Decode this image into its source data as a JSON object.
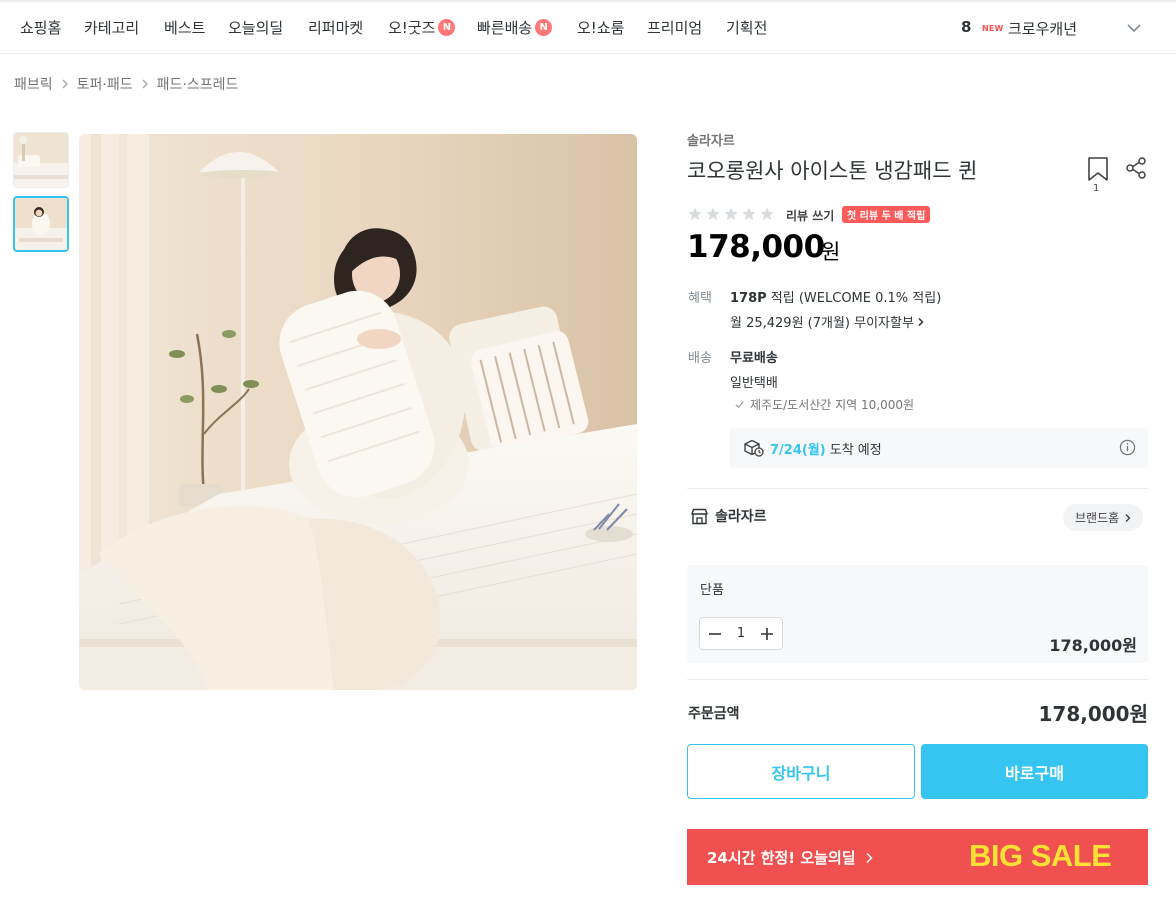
{
  "nav": {
    "items": [
      {
        "label": "쇼핑홈",
        "badge": ""
      },
      {
        "label": "카테고리",
        "badge": ""
      },
      {
        "label": "베스트",
        "badge": ""
      },
      {
        "label": "오늘의딜",
        "badge": ""
      },
      {
        "label": "리퍼마켓",
        "badge": ""
      },
      {
        "label": "오!굿즈",
        "badge": "N"
      },
      {
        "label": "빠른배송",
        "badge": "N"
      },
      {
        "label": "오!쇼룸",
        "badge": ""
      },
      {
        "label": "프리미엄",
        "badge": ""
      },
      {
        "label": "기획전",
        "badge": ""
      }
    ],
    "ranking": {
      "rank": "8",
      "new_tag": "NEW",
      "keyword": "크로우캐년"
    }
  },
  "breadcrumb": [
    "패브릭",
    "토퍼·패드",
    "패드·스프레드"
  ],
  "product": {
    "brand": "솔라자르",
    "title": "코오롱원사 아이스톤 냉감패드 퀸",
    "bookmark_count": "1",
    "review_write": "리뷰 쓰기",
    "review_badge": "첫 리뷰 두 배 적립",
    "price": "178,000",
    "price_unit": "원",
    "rating_stars": 0
  },
  "benefit": {
    "label": "혜택",
    "points": "178P",
    "points_rest": " 적립 (WELCOME 0.1% 적립)",
    "installment": "월 25,429원 (7개월) 무이자할부"
  },
  "shipping": {
    "label": "배송",
    "type": "무료배송",
    "method": "일반택배",
    "extra": "제주도/도서산간 지역 10,000원",
    "eta_date": "7/24(월)",
    "eta_text": "도착 예정"
  },
  "brand_row": {
    "name": "솔라자르",
    "home_button": "브랜드홈"
  },
  "option": {
    "name": "단품",
    "quantity": "1",
    "price": "178,000원"
  },
  "order": {
    "label": "주문금액",
    "total": "178,000원"
  },
  "buttons": {
    "cart": "장바구니",
    "buy": "바로구매"
  },
  "banner": {
    "text": "24시간 한정! 오늘의딜",
    "big": "BIG SALE"
  },
  "colors": {
    "accent": "#35c5f0",
    "badge": "#ff7777",
    "banner_bg": "#f0504f",
    "banner_text": "#ffe135"
  }
}
